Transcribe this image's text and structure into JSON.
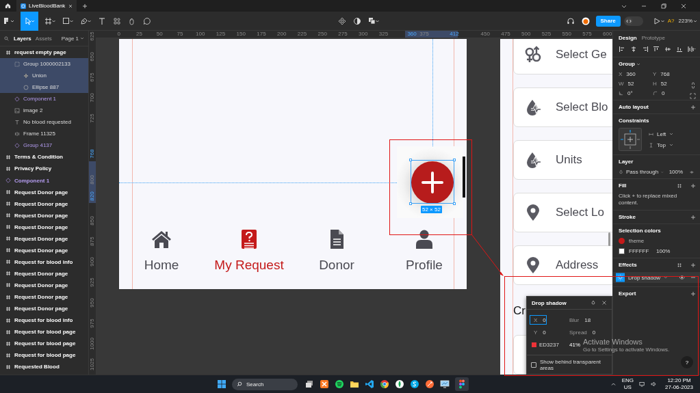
{
  "titlebar": {
    "tabs": [
      {
        "label": "LiveBloodBank",
        "selected": true
      }
    ]
  },
  "toolbar": {
    "share": "Share",
    "dev_mode_on": false,
    "font_warning": "A?",
    "zoom": "223%"
  },
  "left_panel": {
    "tabs": [
      {
        "label": "Layers",
        "selected": true
      },
      {
        "label": "Assets",
        "selected": false
      }
    ],
    "page": "Page 1",
    "layers": [
      {
        "name": "request empty page",
        "kind": "frame",
        "selected": false,
        "children": [
          {
            "name": "Group 1000002133",
            "kind": "group",
            "selected": true,
            "children": [
              {
                "name": "Union",
                "kind": "union",
                "selected": true
              },
              {
                "name": "Ellipse 887",
                "kind": "ellipse",
                "selected": true
              }
            ]
          },
          {
            "name": "Component 1",
            "kind": "instance",
            "selected": false
          },
          {
            "name": "image 2",
            "kind": "image",
            "selected": false
          },
          {
            "name": "No blood requested",
            "kind": "text",
            "selected": false
          },
          {
            "name": "Frame 11325",
            "kind": "autolayout",
            "selected": false
          },
          {
            "name": "Group 4137",
            "kind": "instance",
            "selected": false
          }
        ]
      },
      {
        "name": "Terms & Condition",
        "kind": "frame",
        "selected": false
      },
      {
        "name": "Privacy Policy",
        "kind": "frame",
        "selected": false
      },
      {
        "name": "Component 1",
        "kind": "instance",
        "selected": false
      },
      {
        "name": "Request Donor page",
        "kind": "frame",
        "selected": false
      },
      {
        "name": "Request Donor page",
        "kind": "frame",
        "selected": false
      },
      {
        "name": "Request Donor page",
        "kind": "frame",
        "selected": false
      },
      {
        "name": "Request Donor page",
        "kind": "frame",
        "selected": false
      },
      {
        "name": "Request Donor page",
        "kind": "frame",
        "selected": false
      },
      {
        "name": "Request Donor page",
        "kind": "frame",
        "selected": false
      },
      {
        "name": "Request for blood info",
        "kind": "frame",
        "selected": false
      },
      {
        "name": "Request Donor page",
        "kind": "frame",
        "selected": false
      },
      {
        "name": "Request Donor page",
        "kind": "frame",
        "selected": false
      },
      {
        "name": "Request Donor page",
        "kind": "frame",
        "selected": false
      },
      {
        "name": "Request Donor page",
        "kind": "frame",
        "selected": false
      },
      {
        "name": "Request for blood info",
        "kind": "frame",
        "selected": false
      },
      {
        "name": "Request for blood page",
        "kind": "frame",
        "selected": false
      },
      {
        "name": "Request for blood page",
        "kind": "frame",
        "selected": false
      },
      {
        "name": "Request for blood page",
        "kind": "frame",
        "selected": false
      },
      {
        "name": "Requested Blood",
        "kind": "frame",
        "selected": false
      }
    ]
  },
  "rulers": {
    "top": [
      {
        "label": "0",
        "highlight": false
      },
      {
        "label": "25",
        "highlight": false
      },
      {
        "label": "50",
        "highlight": false
      },
      {
        "label": "75",
        "highlight": false
      },
      {
        "label": "100",
        "highlight": false
      },
      {
        "label": "125",
        "highlight": false
      },
      {
        "label": "150",
        "highlight": false
      },
      {
        "label": "175",
        "highlight": false
      },
      {
        "label": "200",
        "highlight": false
      },
      {
        "label": "225",
        "highlight": false
      },
      {
        "label": "250",
        "highlight": false
      },
      {
        "label": "275",
        "highlight": false
      },
      {
        "label": "300",
        "highlight": false
      },
      {
        "label": "325",
        "highlight": false
      },
      {
        "label": "360",
        "highlight": true
      },
      {
        "label": "375",
        "highlight": false
      },
      {
        "label": "412",
        "highlight": true
      },
      {
        "label": "450",
        "highlight": false
      },
      {
        "label": "475",
        "highlight": false
      },
      {
        "label": "500",
        "highlight": false
      },
      {
        "label": "525",
        "highlight": false
      },
      {
        "label": "550",
        "highlight": false
      },
      {
        "label": "575",
        "highlight": false
      },
      {
        "label": "600",
        "highlight": false
      }
    ],
    "left": [
      {
        "label": "625",
        "highlight": false
      },
      {
        "label": "650",
        "highlight": false
      },
      {
        "label": "675",
        "highlight": false
      },
      {
        "label": "700",
        "highlight": false
      },
      {
        "label": "725",
        "highlight": false
      },
      {
        "label": "768",
        "highlight": true
      },
      {
        "label": "800",
        "highlight": false
      },
      {
        "label": "820",
        "highlight": true
      },
      {
        "label": "850",
        "highlight": false
      },
      {
        "label": "875",
        "highlight": false
      },
      {
        "label": "900",
        "highlight": false
      },
      {
        "label": "925",
        "highlight": false
      },
      {
        "label": "950",
        "highlight": false
      },
      {
        "label": "975",
        "highlight": false
      },
      {
        "label": "1000",
        "highlight": false
      },
      {
        "label": "1025",
        "highlight": false
      }
    ]
  },
  "canvas": {
    "empty_page": {
      "selection_size": "52 × 52",
      "nav": [
        {
          "label": "Home",
          "selected": false
        },
        {
          "label": "My Request",
          "selected": true
        },
        {
          "label": "Donor",
          "selected": false
        },
        {
          "label": "Profile",
          "selected": false
        }
      ]
    },
    "request_page": {
      "fields": [
        "Select Ge",
        "Select Blo",
        "Units",
        "Select Lo",
        "Address"
      ],
      "heading": "Cr"
    }
  },
  "drop_shadow_popup": {
    "title": "Drop shadow",
    "fields": [
      {
        "label": "X",
        "value": "0",
        "selected": true
      },
      {
        "label": "Blur",
        "value": "18",
        "selected": false
      },
      {
        "label": "Y",
        "value": "0",
        "selected": false
      },
      {
        "label": "Spread",
        "value": "0",
        "selected": false
      }
    ],
    "color": "#ed3237",
    "color_label": "ED3237",
    "opacity": "41%",
    "show_behind": {
      "label": "Show behind transparent areas",
      "checked": false
    }
  },
  "right_panel": {
    "tabs": [
      {
        "label": "Design",
        "selected": true
      },
      {
        "label": "Prototype",
        "selected": false
      }
    ],
    "group": {
      "title": "Group",
      "fields": [
        {
          "label": "X",
          "value": "360"
        },
        {
          "label": "Y",
          "value": "768"
        },
        {
          "label": "W",
          "value": "52"
        },
        {
          "label": "H",
          "value": "52"
        }
      ],
      "rotation": "0°",
      "radius": "0"
    },
    "auto_layout": "Auto layout",
    "constraints": {
      "title": "Constraints",
      "horizontal": "Left",
      "vertical": "Top"
    },
    "layer": {
      "title": "Layer",
      "blend": "Pass through",
      "opacity": "100%"
    },
    "fill": {
      "title": "Fill",
      "note": "Click + to replace mixed content."
    },
    "stroke": "Stroke",
    "selection_colors": {
      "title": "Selection colors",
      "colors": [
        {
          "label": "theme",
          "color": "#c41a1a"
        },
        {
          "label": "FFFFFF",
          "color": "#ffffff",
          "opacity": "100%"
        }
      ]
    },
    "effects": {
      "title": "Effects",
      "items": [
        {
          "label": "Drop shadow"
        }
      ]
    },
    "export": "Export",
    "help": "?"
  },
  "os_notice": {
    "title": "Activate Windows",
    "text": "Go to Settings to activate Windows."
  },
  "taskbar": {
    "search": "Search",
    "language": [
      "ENG",
      "US"
    ],
    "time": "12:20 PM",
    "date": "27-06-2023"
  }
}
